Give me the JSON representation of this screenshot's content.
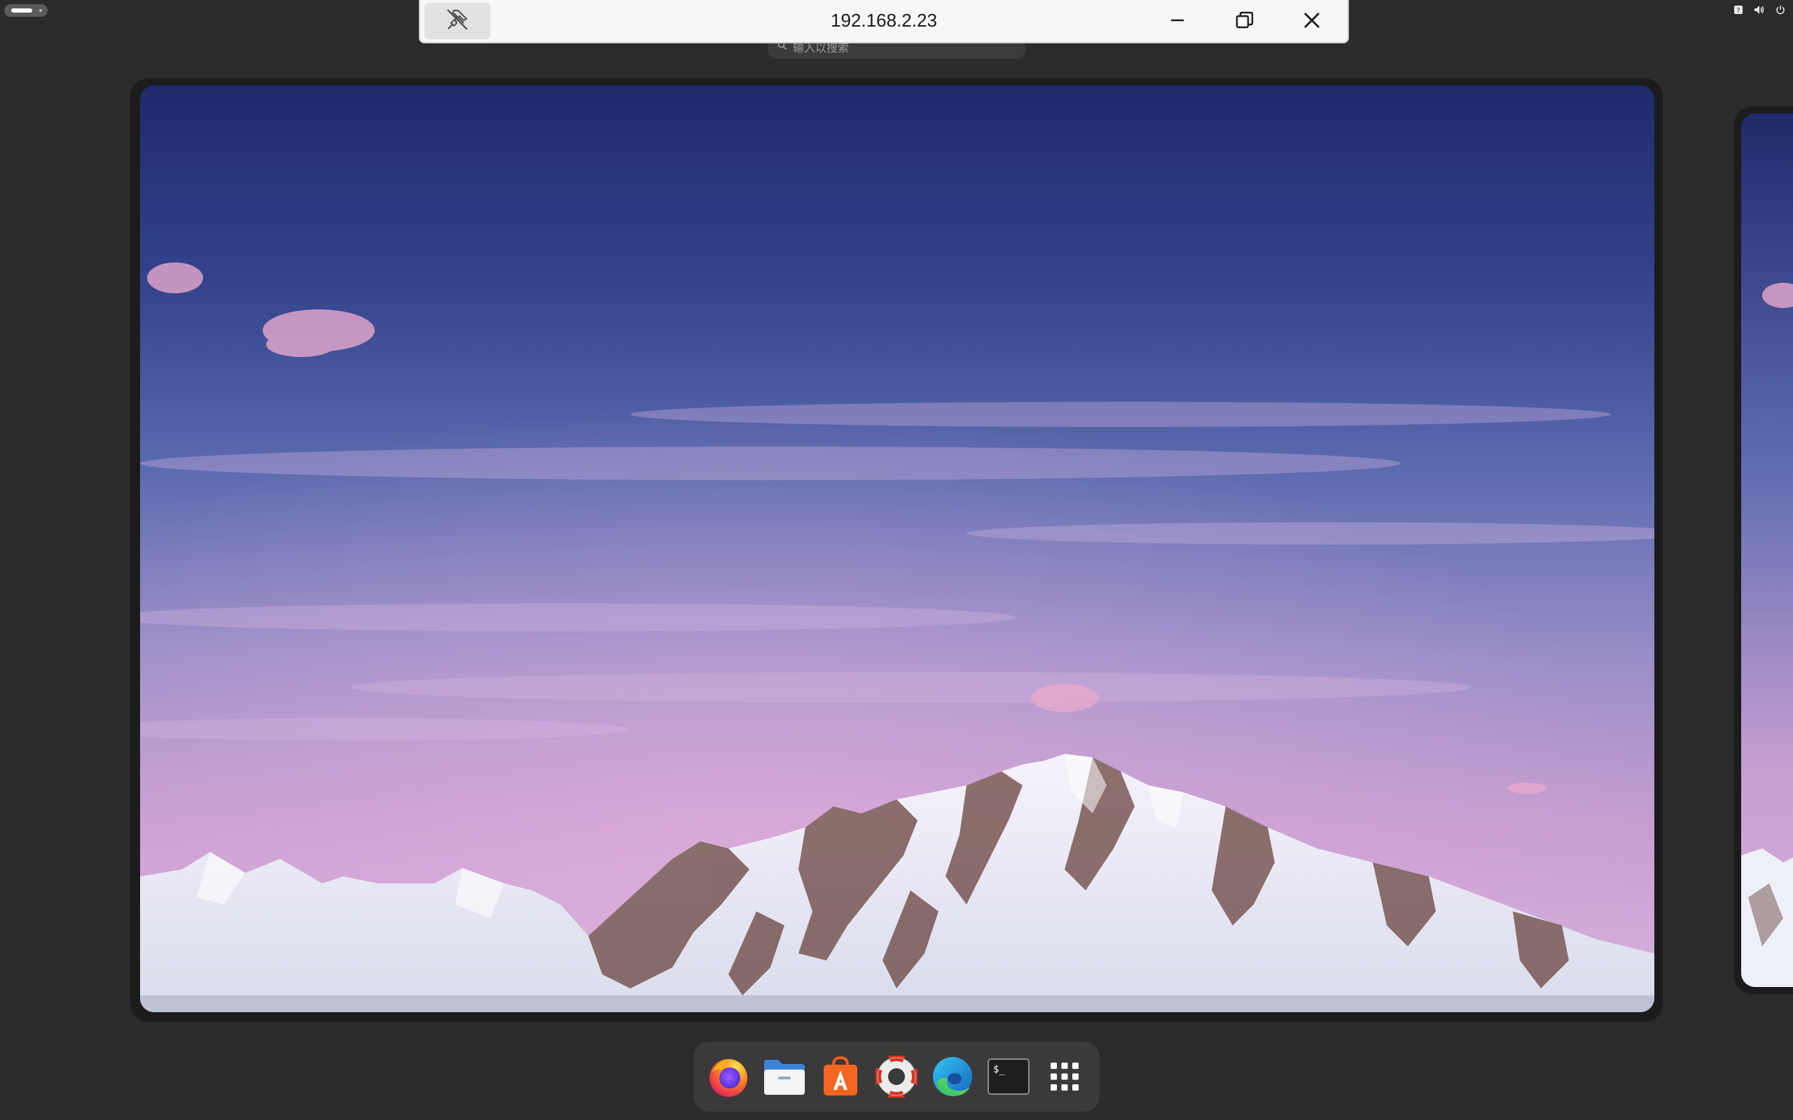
{
  "remote_bar": {
    "title": "192.168.2.23",
    "pin_icon": "pin-off-icon",
    "minimize_icon": "minimize-icon",
    "restore_icon": "restore-icon",
    "close_icon": "close-icon"
  },
  "overview": {
    "search_placeholder": "输入以搜索"
  },
  "dock": {
    "items": [
      {
        "name": "Firefox",
        "icon": "firefox-icon"
      },
      {
        "name": "Files",
        "icon": "files-icon"
      },
      {
        "name": "Software",
        "icon": "software-store-icon"
      },
      {
        "name": "Help",
        "icon": "help-lifebuoy-icon"
      },
      {
        "name": "Microsoft Edge",
        "icon": "edge-icon"
      },
      {
        "name": "Terminal",
        "icon": "terminal-icon",
        "glyph": "$_"
      },
      {
        "name": "Show Applications",
        "icon": "app-grid-icon"
      }
    ]
  },
  "system_tray": {
    "icons": [
      "help-icon",
      "volume-icon",
      "power-icon"
    ],
    "help_glyph": "?"
  },
  "colors": {
    "panel_bg": "#2b2b2b",
    "dock_bg": "#3a3a3a",
    "remote_bar_bg": "#f7f7f7"
  }
}
